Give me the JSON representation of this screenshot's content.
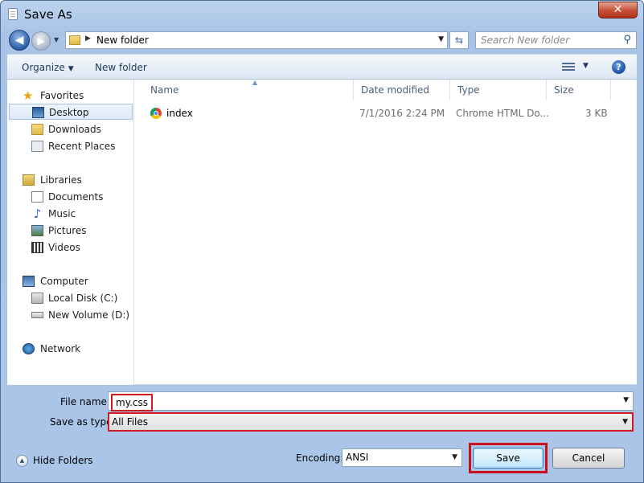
{
  "window": {
    "title": "Save As",
    "close_label": "✕"
  },
  "nav": {
    "address_path": "New folder",
    "search_placeholder": "Search New folder"
  },
  "toolbar": {
    "organize_label": "Organize",
    "new_folder_label": "New folder",
    "help_label": "?"
  },
  "sidebar": {
    "favorites": "Favorites",
    "desktop": "Desktop",
    "downloads": "Downloads",
    "recent_places": "Recent Places",
    "libraries": "Libraries",
    "documents": "Documents",
    "music": "Music",
    "pictures": "Pictures",
    "videos": "Videos",
    "computer": "Computer",
    "local_disk": "Local Disk (C:)",
    "new_volume": "New Volume (D:)",
    "network": "Network",
    "selected": "Desktop"
  },
  "columns": {
    "name": "Name",
    "date_modified": "Date modified",
    "type": "Type",
    "size": "Size"
  },
  "files": [
    {
      "name": "index",
      "date_modified": "7/1/2016 2:24 PM",
      "type": "Chrome HTML Do...",
      "size": "3 KB"
    }
  ],
  "form": {
    "file_name_label": "File name:",
    "file_name_value": "my.css",
    "save_type_label": "Save as type:",
    "save_type_value": "All Files",
    "encoding_label": "Encoding:",
    "encoding_value": "ANSI"
  },
  "footer": {
    "hide_folders_label": "Hide Folders",
    "save_label": "Save",
    "cancel_label": "Cancel"
  },
  "colors": {
    "highlight_red": "#d01c1c",
    "title_blue": "#aac5e7"
  }
}
